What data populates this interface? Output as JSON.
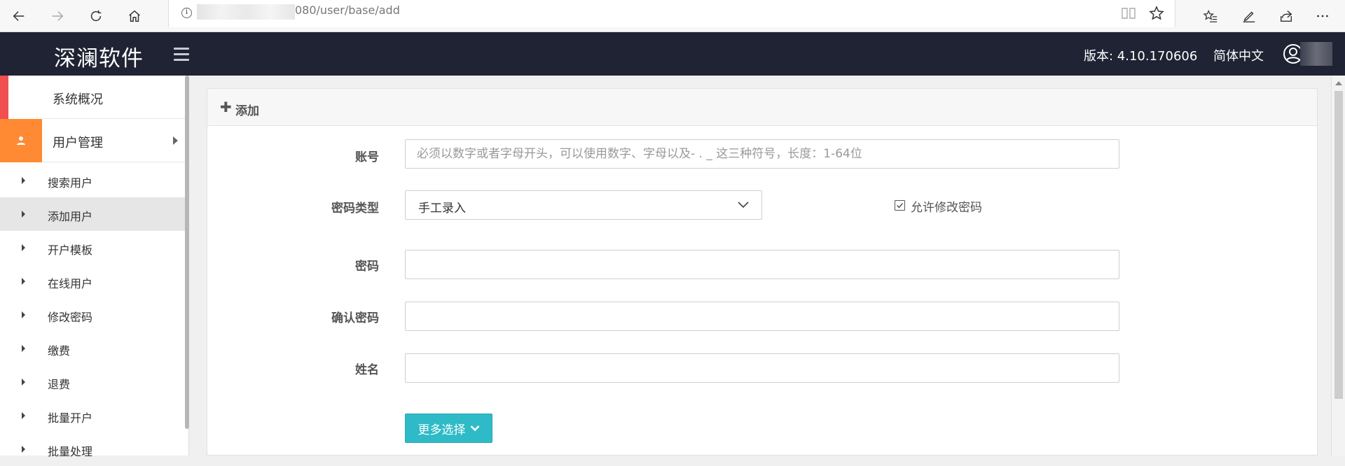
{
  "browser": {
    "url": "080/user/base/add"
  },
  "header": {
    "logo": "深澜软件",
    "version": "版本: 4.10.170606",
    "language": "简体中文"
  },
  "sidebar": {
    "top_items": [
      {
        "label": "系统概况",
        "badge_color": "#f05050"
      },
      {
        "label": "用户管理",
        "badge_color": "#ff8a33"
      }
    ],
    "sub_items": [
      {
        "label": "搜索用户"
      },
      {
        "label": "添加用户"
      },
      {
        "label": "开户模板"
      },
      {
        "label": "在线用户"
      },
      {
        "label": "修改密码"
      },
      {
        "label": "缴费"
      },
      {
        "label": "退费"
      },
      {
        "label": "批量开户"
      },
      {
        "label": "批量处理"
      }
    ],
    "active_sub_item": "添加用户"
  },
  "panel": {
    "title": "添加",
    "fields": {
      "account_label": "账号",
      "account_placeholder": "必须以数字或者字母开头，可以使用数字、字母以及- . _ 这三种符号，长度：1-64位",
      "password_type_label": "密码类型",
      "password_type_value": "手工录入",
      "allow_change_password": "允许修改密码",
      "password_label": "密码",
      "confirm_password_label": "确认密码",
      "name_label": "姓名"
    },
    "more_button": "更多选择"
  },
  "colors": {
    "header_bg": "#1f2333",
    "accent_button": "#2fbac7"
  }
}
